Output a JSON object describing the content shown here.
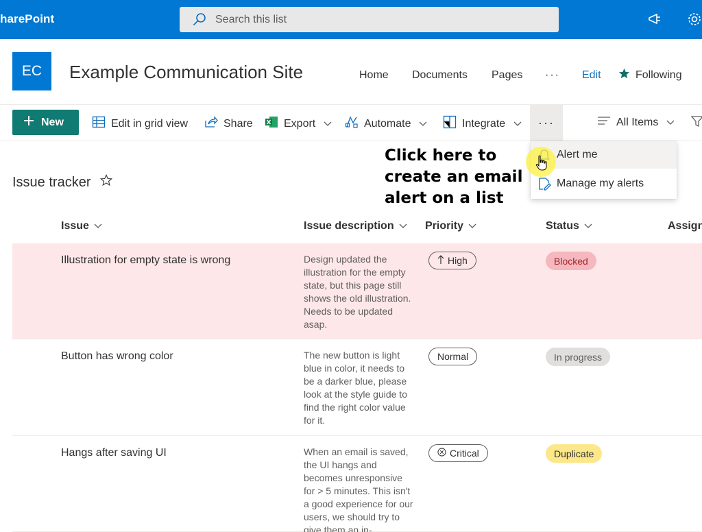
{
  "suitebar": {
    "brand": "harePoint",
    "search_placeholder": "Search this list",
    "color": "#0078d4"
  },
  "site": {
    "logo_text": "EC",
    "title": "Example Communication Site",
    "nav": [
      "Home",
      "Documents",
      "Pages",
      "···",
      "Edit"
    ],
    "following_label": "Following"
  },
  "commandbar": {
    "new_label": "New",
    "edit_grid_label": "Edit in grid view",
    "share_label": "Share",
    "export_label": "Export",
    "automate_label": "Automate",
    "integrate_label": "Integrate",
    "more_label": "···",
    "view_label": "All Items"
  },
  "menu": {
    "items": [
      "Alert me",
      "Manage my alerts"
    ]
  },
  "annotation": {
    "lines": [
      "Click here to",
      "create an email",
      "alert on a list"
    ]
  },
  "list": {
    "title": "Issue tracker",
    "columns": [
      "Issue",
      "Issue description",
      "Priority",
      "Status",
      "Assigne"
    ],
    "rows": [
      {
        "issue": "Illustration for empty state is wrong",
        "description": "Design updated the illustration for the empty state, but this page still shows the old illustration. Needs to be updated asap.",
        "priority": "High",
        "status": "Blocked",
        "status_bg": "#f4b8be",
        "status_fg": "#a4262c"
      },
      {
        "issue": "Button has wrong color",
        "description": "The new button is light blue in color, it needs to be a darker blue, please look at the style guide to find the right color value for it.",
        "priority": "Normal",
        "status": "In progress",
        "status_bg": "#e1dfdd",
        "status_fg": "#605e5c"
      },
      {
        "issue": "Hangs after saving UI",
        "description": "When an email is saved, the UI hangs and becomes unresponsive for > 5 minutes. This isn't a good experience for our users, we should try to give them an in-",
        "priority": "Critical",
        "status": "Duplicate",
        "status_bg": "#fce88a",
        "status_fg": "#323130"
      }
    ]
  }
}
